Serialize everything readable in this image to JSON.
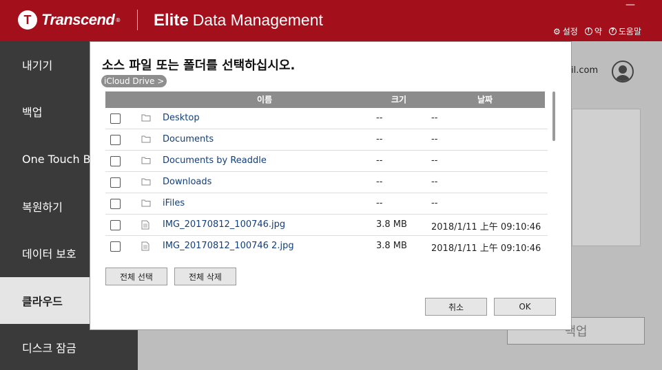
{
  "header": {
    "brand": "Transcend",
    "brand_sup": "®",
    "product_elite": "Elite",
    "product_name": "Data Management",
    "minimize": "—",
    "links": [
      {
        "label": "설정",
        "icon": "gear-icon"
      },
      {
        "label": "약",
        "icon": "alert-icon"
      },
      {
        "label": "도움말",
        "icon": "help-icon"
      }
    ]
  },
  "sidebar": {
    "items": [
      {
        "label": "내기기",
        "active": false
      },
      {
        "label": "백업",
        "active": false
      },
      {
        "label": "One Touch Ba",
        "active": false
      },
      {
        "label": "복원하기",
        "active": false
      },
      {
        "label": "데이터 보호",
        "active": false
      },
      {
        "label": "클라우드",
        "active": true
      },
      {
        "label": "디스크 잠금",
        "active": false
      }
    ]
  },
  "main": {
    "account_text": "il.com",
    "backup_button": "백업"
  },
  "dialog": {
    "title": "소스 파일 또는 폴더를 선택하십시오.",
    "breadcrumb": "iCloud Drive >",
    "columns": {
      "name": "이름",
      "size": "크기",
      "date": "날짜"
    },
    "rows": [
      {
        "type": "folder",
        "name": "Desktop",
        "size": "--",
        "date": "--"
      },
      {
        "type": "folder",
        "name": "Documents",
        "size": "--",
        "date": "--"
      },
      {
        "type": "folder",
        "name": "Documents by Readdle",
        "size": "--",
        "date": "--"
      },
      {
        "type": "folder",
        "name": "Downloads",
        "size": "--",
        "date": "--"
      },
      {
        "type": "folder",
        "name": "iFiles",
        "size": "--",
        "date": "--"
      },
      {
        "type": "file",
        "name": "IMG_20170812_100746.jpg",
        "size": "3.8 MB",
        "date": "2018/1/11 上午 09:10:46"
      },
      {
        "type": "file",
        "name": "IMG_20170812_100746 2.jpg",
        "size": "3.8 MB",
        "date": "2018/1/11 上午 09:10:46"
      }
    ],
    "select_all": "전체 선택",
    "delete_all": "전체 삭제",
    "cancel": "취소",
    "ok": "OK"
  }
}
